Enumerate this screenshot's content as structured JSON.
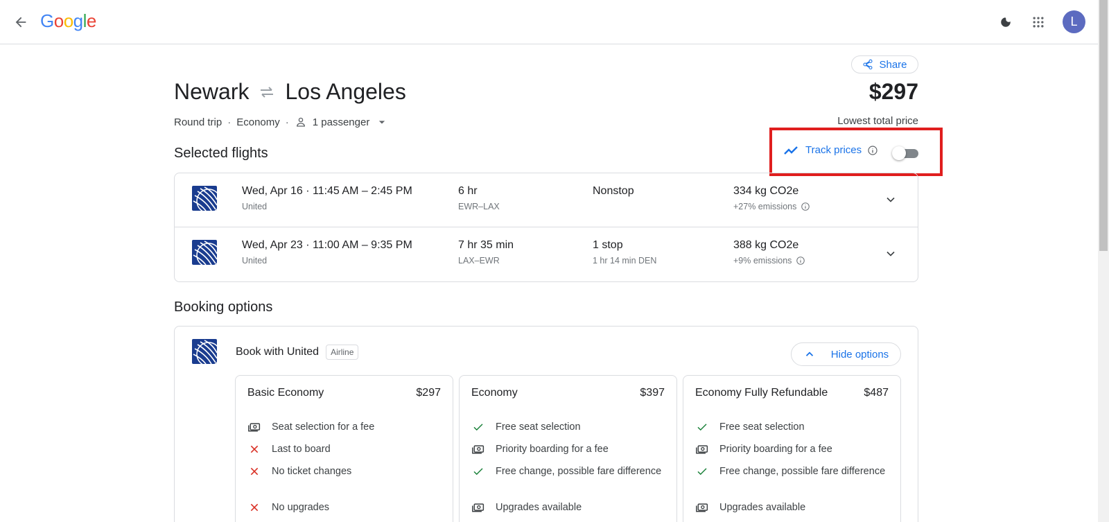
{
  "header": {
    "logo_letters": [
      {
        "ch": "G",
        "color": "#4285F4"
      },
      {
        "ch": "o",
        "color": "#EA4335"
      },
      {
        "ch": "o",
        "color": "#FBBC05"
      },
      {
        "ch": "g",
        "color": "#4285F4"
      },
      {
        "ch": "l",
        "color": "#34A853"
      },
      {
        "ch": "e",
        "color": "#EA4335"
      }
    ],
    "avatar_initial": "L"
  },
  "share_label": "Share",
  "route": {
    "origin": "Newark",
    "destination": "Los Angeles"
  },
  "price": {
    "amount": "$297",
    "label": "Lowest total price"
  },
  "trip": {
    "type": "Round trip",
    "cabin": "Economy",
    "passengers": "1 passenger"
  },
  "selected_flights": {
    "title": "Selected flights",
    "track_prices_label": "Track prices",
    "track_prices_on": false,
    "flights": [
      {
        "date_time": "Wed, Apr 16  ·  11:45 AM – 2:45 PM",
        "airline": "United",
        "duration": "6 hr",
        "route": "EWR–LAX",
        "stops": "Nonstop",
        "stop_detail": "",
        "emissions": "334 kg CO2e",
        "emissions_delta": "+27% emissions"
      },
      {
        "date_time": "Wed, Apr 23  ·  11:00 AM – 9:35 PM",
        "airline": "United",
        "duration": "7 hr 35 min",
        "route": "LAX–EWR",
        "stops": "1 stop",
        "stop_detail": "1 hr 14 min DEN",
        "emissions": "388 kg CO2e",
        "emissions_delta": "+9% emissions"
      }
    ]
  },
  "booking": {
    "title": "Booking options",
    "book_with": "Book with United",
    "badge": "Airline",
    "hide_label": "Hide options",
    "fares": [
      {
        "name": "Basic Economy",
        "price": "$297",
        "features": [
          {
            "icon": "fee-icon",
            "text": "Seat selection for a fee"
          },
          {
            "icon": "x-icon",
            "text": "Last to board"
          },
          {
            "icon": "x-icon",
            "text": "No ticket changes"
          },
          {
            "icon": "x-icon",
            "text": "No upgrades"
          }
        ]
      },
      {
        "name": "Economy",
        "price": "$397",
        "features": [
          {
            "icon": "check-icon",
            "text": "Free seat selection"
          },
          {
            "icon": "fee-icon",
            "text": "Priority boarding for a fee"
          },
          {
            "icon": "check-icon",
            "text": "Free change, possible fare difference"
          },
          {
            "icon": "fee-icon",
            "text": "Upgrades available"
          }
        ]
      },
      {
        "name": "Economy Fully Refundable",
        "price": "$487",
        "features": [
          {
            "icon": "check-icon",
            "text": "Free seat selection"
          },
          {
            "icon": "fee-icon",
            "text": "Priority boarding for a fee"
          },
          {
            "icon": "check-icon",
            "text": "Free change, possible fare difference"
          },
          {
            "icon": "fee-icon",
            "text": "Upgrades available"
          }
        ]
      }
    ]
  },
  "colors": {
    "accent": "#1a73e8",
    "check": "#188038",
    "cross": "#d93025",
    "highlight": "#e01e1e",
    "united_blue": "#1a3c8f"
  }
}
